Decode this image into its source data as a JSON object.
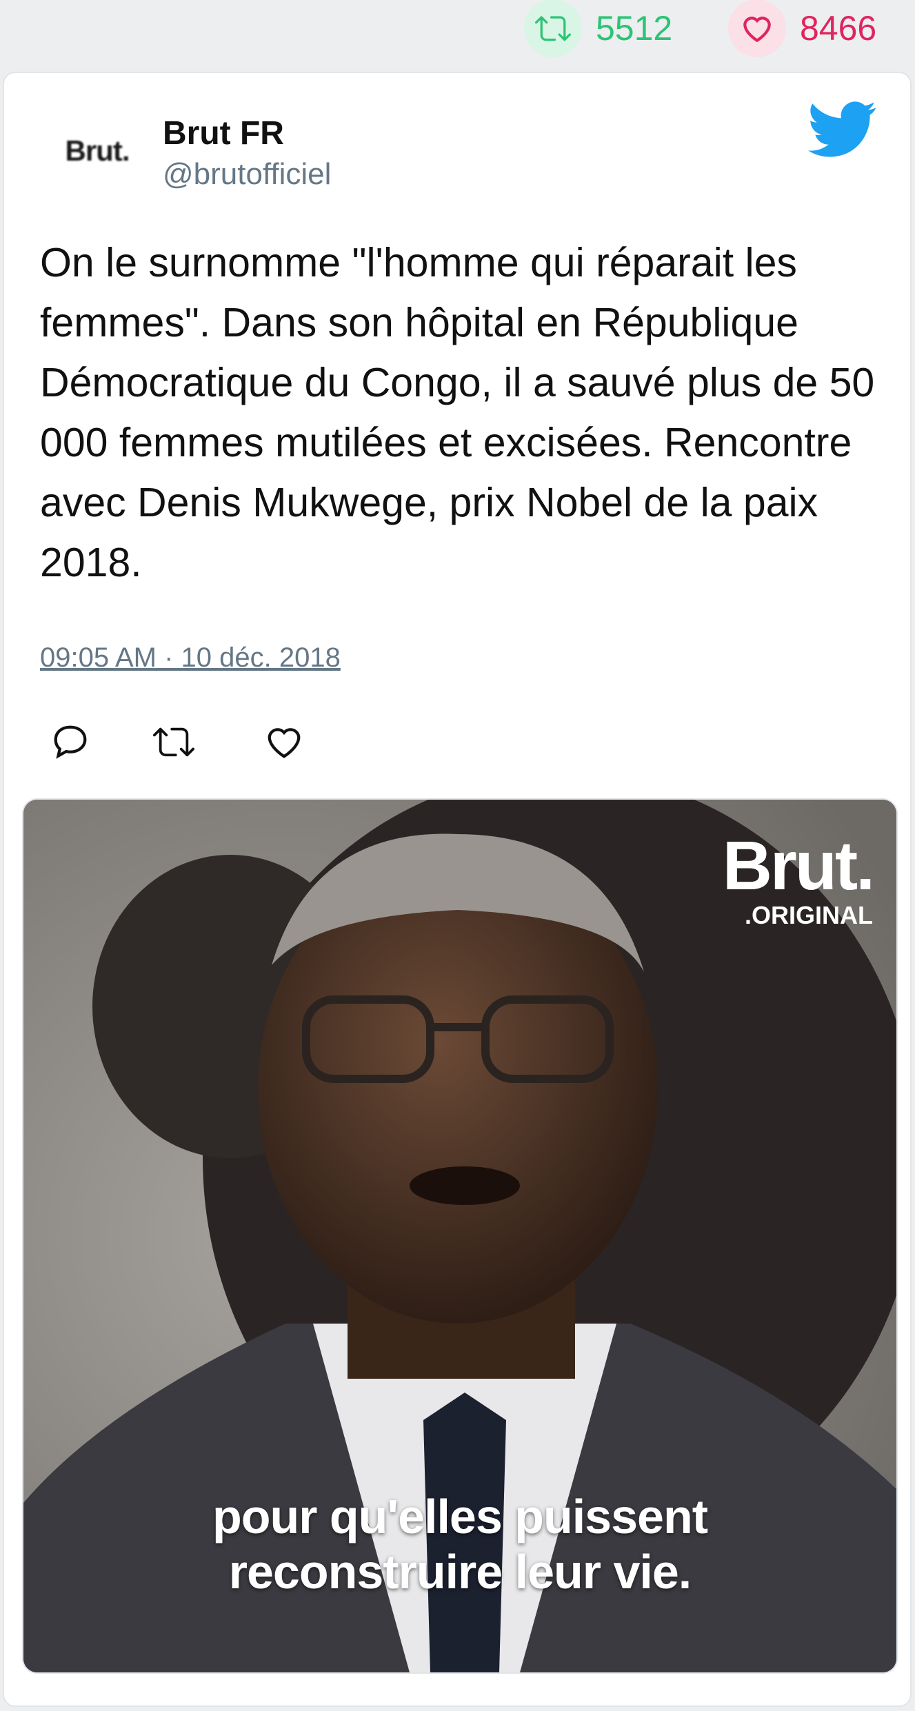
{
  "stats": {
    "retweets": "5512",
    "likes": "8466",
    "retweet_color": "#2bc475",
    "like_color": "#e0245e"
  },
  "author": {
    "name": "Brut FR",
    "handle": "@brutofficiel",
    "avatar_text": "Brut."
  },
  "tweet": {
    "text": "On le surnomme \"l'homme qui réparait les femmes\". Dans son hôpital en République Démocratique du Congo, il a sauvé plus de 50 000 femmes mutilées et excisées. Rencontre avec Denis Mukwege, prix Nobel de la paix 2018.",
    "timestamp": "09:05 AM · 10 déc. 2018"
  },
  "actions": [
    "reply-icon",
    "retweet-icon",
    "like-icon"
  ],
  "media": {
    "brand_main": "Brut.",
    "brand_sub": ".ORIGINAL",
    "caption_line1": "pour qu'elles puissent",
    "caption_line2": "reconstruire leur vie."
  },
  "icons": {
    "twitter_brand": "twitter-bird-icon"
  },
  "colors": {
    "twitter_blue": "#1da1f2",
    "muted": "#657786"
  }
}
